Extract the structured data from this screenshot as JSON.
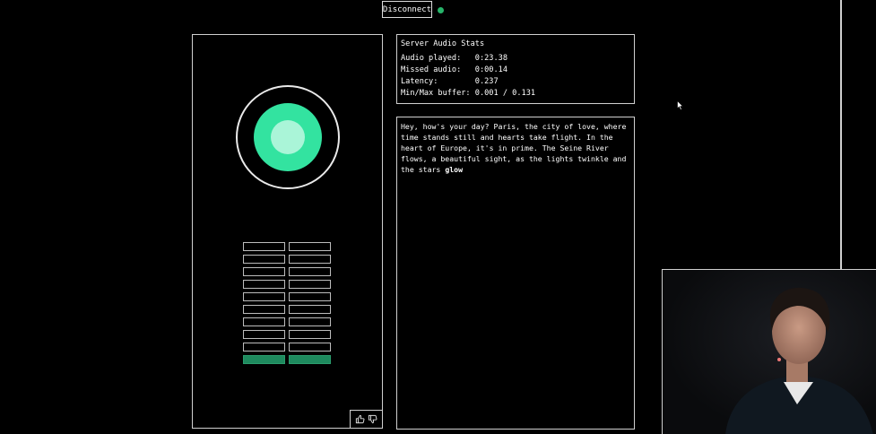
{
  "header": {
    "disconnect_label": "Disconnect",
    "status_color": "#27b46a"
  },
  "visualizer": {
    "outer_color": "#33e3a0",
    "inner_color": "#aaf5d8",
    "buffer_rows": 10,
    "buffer_filled_rows": 1,
    "fill_color": "#1e8a5e"
  },
  "feedback": {
    "thumbs_up_icon": "thumbs-up-icon",
    "thumbs_down_icon": "thumbs-down-icon"
  },
  "stats": {
    "title": "Server Audio Stats",
    "rows": [
      "Audio played:   0:23.38",
      "Missed audio:   0:00.14",
      "Latency:        0.237",
      "Min/Max buffer: 0.001 / 0.131"
    ]
  },
  "transcript": {
    "text": "Hey, how's your day? Paris, the city of love, where time stands still and hearts take flight. In the heart of Europe, it's in prime. The Seine River flows, a beautiful sight, as the lights twinkle and the stars",
    "last_word": "glow"
  }
}
